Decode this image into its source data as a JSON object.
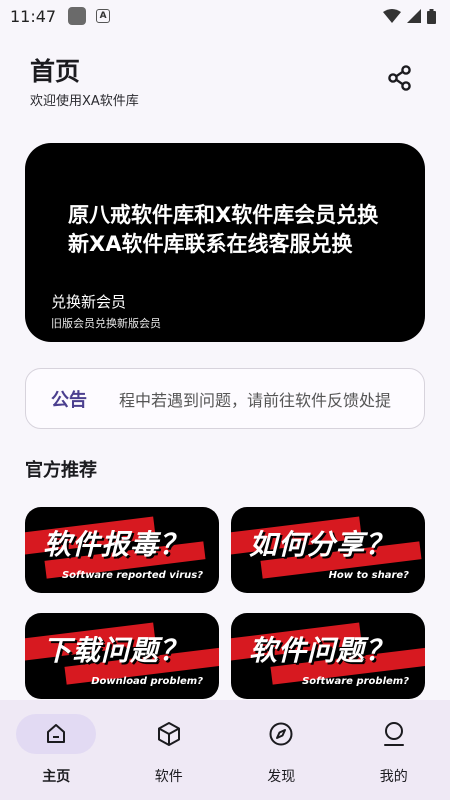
{
  "status_bar": {
    "time": "11:47",
    "a_glyph": "A"
  },
  "header": {
    "title": "首页",
    "subtitle": "欢迎使用XA软件库"
  },
  "banner": {
    "text": "原八戒软件库和X软件库会员兑换新XA软件库联系在线客服兑换",
    "title": "兑换新会员",
    "subtitle": "旧版会员兑换新版会员"
  },
  "notice": {
    "label": "公告",
    "text": "程中若遇到问题，请前往软件反馈处提"
  },
  "section": {
    "title": "官方推荐"
  },
  "cards": [
    {
      "title": "软件报毒？",
      "subtitle": "Software reported virus?"
    },
    {
      "title": "如何分享？",
      "subtitle": "How to share?"
    },
    {
      "title": "下载问题？",
      "subtitle": "Download problem?"
    },
    {
      "title": "软件问题？",
      "subtitle": "Software problem?"
    }
  ],
  "nav": [
    {
      "label": "主页",
      "icon": "home-icon",
      "active": true
    },
    {
      "label": "软件",
      "icon": "box-icon",
      "active": false
    },
    {
      "label": "发现",
      "icon": "compass-icon",
      "active": false
    },
    {
      "label": "我的",
      "icon": "person-icon",
      "active": false
    }
  ],
  "colors": {
    "accent": "#4b3f8f",
    "card_red": "#d71920",
    "nav_bg": "#efe9f5",
    "nav_active_pill": "#e2daf3"
  }
}
